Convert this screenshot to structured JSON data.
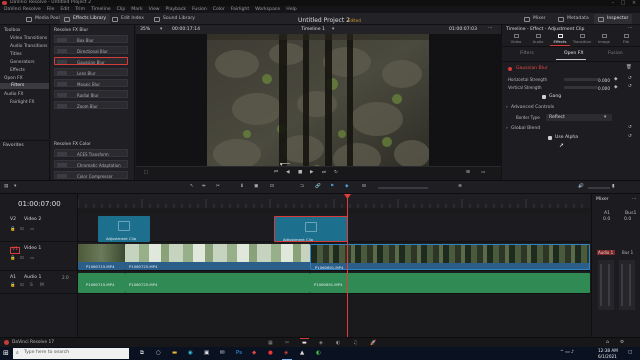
{
  "window": {
    "title": "DaVinci Resolve - Untitled Project 2"
  },
  "menu": [
    "DaVinci Resolve",
    "File",
    "Edit",
    "Trim",
    "Timeline",
    "Clip",
    "Mark",
    "View",
    "Playback",
    "Fusion",
    "Color",
    "Fairlight",
    "Workspace",
    "Help"
  ],
  "toolbar": {
    "media_pool": "Media Pool",
    "effects_library": "Effects Library",
    "edit_index": "Edit Index",
    "sound_library": "Sound Library",
    "project_title": "Untitled Project 2",
    "project_status": "Edited",
    "mixer": "Mixer",
    "metadata": "Metadata",
    "inspector": "Inspector"
  },
  "leftnav": {
    "items": [
      "Toolbox",
      "Video Transitions",
      "Audio Transitions",
      "Titles",
      "Generators",
      "Effects",
      "Open FX",
      "Filters",
      "Audio FX",
      "Fairlight FX"
    ],
    "selected": "Filters",
    "favorites": "Favorites"
  },
  "effects": {
    "section1": "Resolve FX Blur",
    "items1": [
      "Box Blur",
      "Directional Blur",
      "Gaussian Blur",
      "Lens Blur",
      "Mosaic Blur",
      "Radial Blur",
      "Zoom Blur"
    ],
    "selected": "Gaussian Blur",
    "section2": "Resolve FX Color",
    "items2": [
      "ACES Transform",
      "Chromatic Adaptation",
      "Color Compressor"
    ]
  },
  "viewer": {
    "zoom": "35%",
    "timecode_left": "00:00:17:14",
    "timeline_name": "Timeline 1",
    "timecode_right": "01:00:07:03"
  },
  "inspector": {
    "header": "Timeline - Effect - Adjustment Clip",
    "tabs": [
      "Video",
      "Audio",
      "Effects",
      "Transition",
      "Image",
      "File"
    ],
    "selected_tab": "Effects",
    "subtabs": [
      "Filters",
      "Open FX",
      "Fusion"
    ],
    "effect_name": "Gaussian Blur",
    "horizontal_label": "Horizontal Strength",
    "horizontal_value": "0.000",
    "vertical_label": "Vertical Strength",
    "vertical_value": "0.000",
    "gang_label": "Gang",
    "advanced": "Advanced Controls",
    "border_label": "Border Type",
    "border_value": "Reflect",
    "global_blend": "Global Blend",
    "use_alpha": "Use Alpha"
  },
  "timeline": {
    "timecode": "01:00:07:00",
    "tracks": [
      {
        "id": "V2",
        "name": "Video 2"
      },
      {
        "id": "V1",
        "name": "Video 1"
      },
      {
        "id": "A1",
        "name": "Audio 1",
        "level": "2.0"
      }
    ],
    "adjustment_label": "Adjustment Clip",
    "v1_clips": [
      "P1060715.MP4",
      "P1060725.MP4",
      "P1060691.MP4"
    ],
    "a1_clips": [
      "P1060715.MP4",
      "P1060725.MP4",
      "P1060691.MP4"
    ],
    "ruler": [
      "01:00:00:00",
      "01:00:04:00",
      "01:00:08:00",
      "01:00:12:00"
    ]
  },
  "mixer": {
    "title": "Mixer",
    "channels": [
      "A1",
      "Bus1"
    ],
    "values": [
      "0.0",
      "0.0"
    ],
    "audio_label": "Audio 1",
    "bus_label": "Bus 1"
  },
  "pages": [
    "Media",
    "Cut",
    "Edit",
    "Fusion",
    "Color",
    "Fairlight",
    "Deliver"
  ],
  "app_name": "DaVinci Resolve 17",
  "taskbar": {
    "search_placeholder": "Type here to search",
    "time": "12:38 AM",
    "date": "6/1/2021"
  },
  "colors": {
    "accent_red": "#d43c3c",
    "adjustment_clip": "#1d6f8e",
    "video_clip": "#2b5f8a",
    "audio_clip": "#2f8a54",
    "playhead": "#e23b3b"
  }
}
